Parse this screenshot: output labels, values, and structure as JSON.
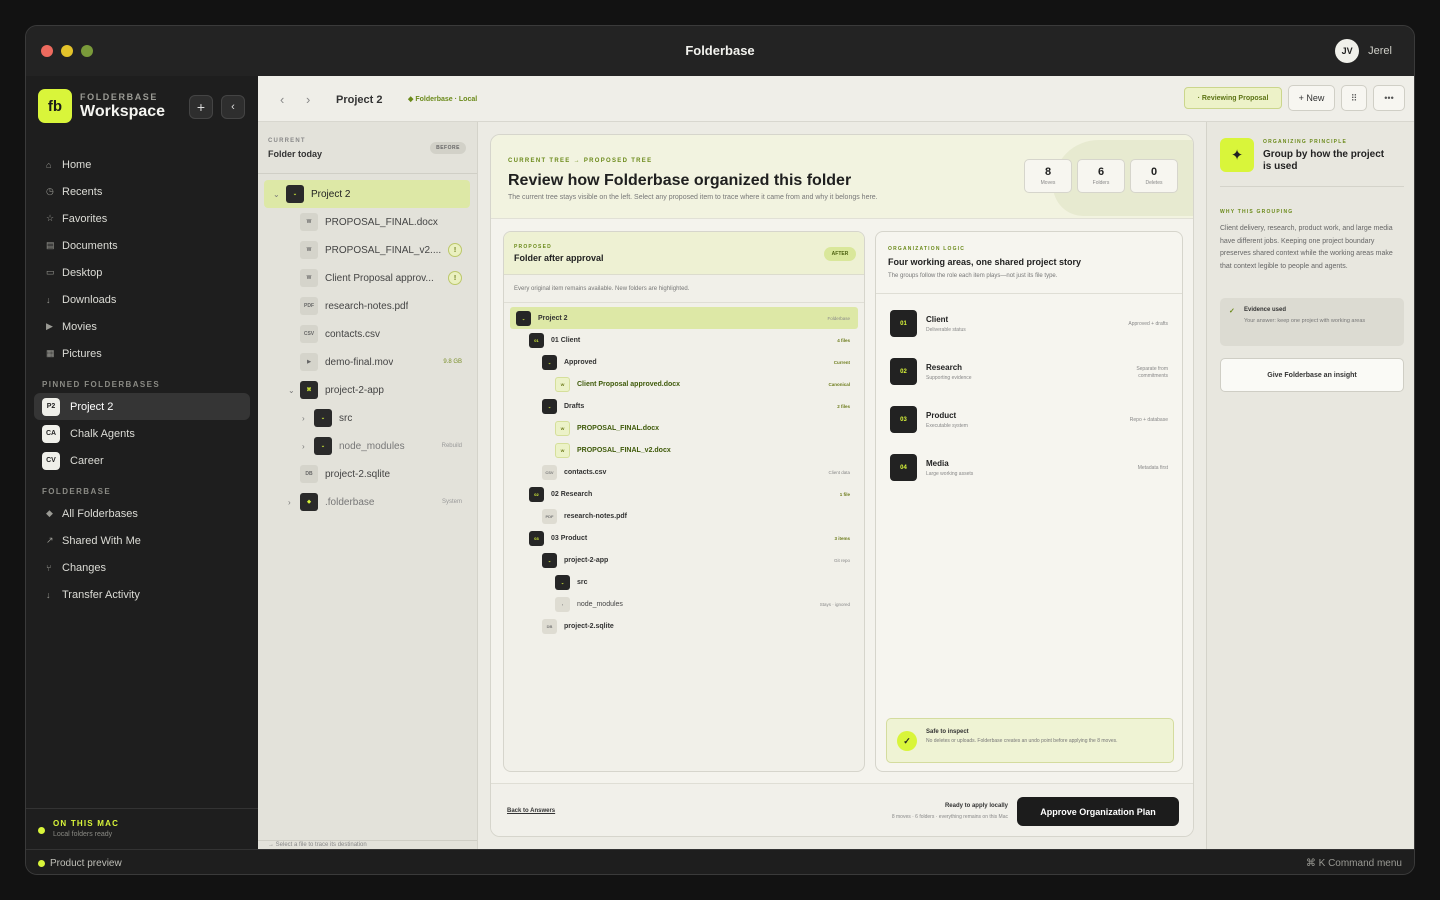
{
  "window": {
    "title": "Folderbase",
    "user_initials": "JV",
    "user_name": "Jerel"
  },
  "sidebar": {
    "brand_small": "FOLDERBASE",
    "brand_big": "Workspace",
    "logo": "fb",
    "nav": [
      {
        "label": "Home",
        "icon": "home-icon"
      },
      {
        "label": "Recents",
        "icon": "clock-icon"
      },
      {
        "label": "Favorites",
        "icon": "star-icon"
      },
      {
        "label": "Documents",
        "icon": "document-icon"
      },
      {
        "label": "Desktop",
        "icon": "desktop-icon"
      },
      {
        "label": "Downloads",
        "icon": "download-icon"
      },
      {
        "label": "Movies",
        "icon": "play-icon"
      },
      {
        "label": "Pictures",
        "icon": "image-icon"
      }
    ],
    "pinned_title": "PINNED FOLDERBASES",
    "pinned": [
      {
        "badge": "P2",
        "label": "Project 2"
      },
      {
        "badge": "CA",
        "label": "Chalk Agents"
      },
      {
        "badge": "CV",
        "label": "Career"
      }
    ],
    "folderbase_title": "FOLDERBASE",
    "folderbase_nav": [
      {
        "label": "All Folderbases",
        "icon": "diamond-icon"
      },
      {
        "label": "Shared With Me",
        "icon": "share-icon"
      },
      {
        "label": "Changes",
        "icon": "branch-icon"
      },
      {
        "label": "Transfer Activity",
        "icon": "transfer-icon"
      }
    ],
    "footer_title": "ON THIS MAC",
    "footer_sub": "Local folders ready"
  },
  "toolbar": {
    "title": "Project 2",
    "crumb": "◆ Folderbase · Local",
    "status_pill": "· Reviewing Proposal",
    "new_label": "+ New"
  },
  "current": {
    "label": "CURRENT",
    "title": "Folder today",
    "pill": "BEFORE",
    "footer": "→  Select a file to trace its destination",
    "rows": [
      {
        "name": "Project 2",
        "icon": "⌄",
        "meta": ""
      },
      {
        "name": "PROPOSAL_FINAL.docx",
        "icon": "W",
        "meta": ""
      },
      {
        "name": "PROPOSAL_FINAL_v2....",
        "icon": "W",
        "meta": "!"
      },
      {
        "name": "Client Proposal approv...",
        "icon": "W",
        "meta": "!"
      },
      {
        "name": "research-notes.pdf",
        "icon": "PDF",
        "meta": ""
      },
      {
        "name": "contacts.csv",
        "icon": "CSV",
        "meta": ""
      },
      {
        "name": "demo-final.mov",
        "icon": "▶",
        "meta": "9.8 GB"
      },
      {
        "name": "project-2-app",
        "icon": "⌘",
        "meta": ""
      },
      {
        "name": "src",
        "icon": "⌄",
        "meta": ""
      },
      {
        "name": "node_modules",
        "icon": "⌄",
        "meta": "Rebuild"
      },
      {
        "name": "project-2.sqlite",
        "icon": "DB",
        "meta": ""
      },
      {
        "name": ".folderbase",
        "icon": "◆",
        "meta": "System"
      }
    ]
  },
  "hero": {
    "eyebrow": "CURRENT TREE → PROPOSED TREE",
    "title": "Review how Folderbase organized this folder",
    "subtitle": "The current tree stays visible on the left. Select any proposed item to trace where it came from and why it belongs here.",
    "stats": [
      {
        "num": "8",
        "label": "Moves"
      },
      {
        "num": "6",
        "label": "Folders"
      },
      {
        "num": "0",
        "label": "Deletes"
      }
    ]
  },
  "proposed": {
    "eyebrow": "PROPOSED",
    "title": "Folder after approval",
    "pill": "AFTER",
    "note": "Every original item remains available. New folders are highlighted.",
    "rows": [
      {
        "name": "Project 2",
        "icon": "⌄",
        "meta": "Folderbase"
      },
      {
        "name": "01 Client",
        "icon": "01",
        "meta": "4 files"
      },
      {
        "name": "Approved",
        "icon": "⌄",
        "meta": "Current"
      },
      {
        "name": "Client Proposal approved.docx",
        "icon": "W",
        "meta": "Canonical"
      },
      {
        "name": "Drafts",
        "icon": "⌄",
        "meta": "2 files"
      },
      {
        "name": "PROPOSAL_FINAL.docx",
        "icon": "W",
        "meta": ""
      },
      {
        "name": "PROPOSAL_FINAL_v2.docx",
        "icon": "W",
        "meta": ""
      },
      {
        "name": "contacts.csv",
        "icon": "CSV",
        "meta": "Client data"
      },
      {
        "name": "02 Research",
        "icon": "02",
        "meta": "1 file"
      },
      {
        "name": "research-notes.pdf",
        "icon": "PDF",
        "meta": ""
      },
      {
        "name": "03 Product",
        "icon": "03",
        "meta": "3 items"
      },
      {
        "name": "project-2-app",
        "icon": "⌄",
        "meta": "Git repo"
      },
      {
        "name": "src",
        "icon": "⌄",
        "meta": ""
      },
      {
        "name": "node_modules",
        "icon": "›",
        "meta": "Stays · ignored"
      },
      {
        "name": "project-2.sqlite",
        "icon": "DB",
        "meta": ""
      }
    ]
  },
  "logic": {
    "eyebrow": "ORGANIZATION LOGIC",
    "title": "Four working areas, one shared project story",
    "subtitle": "The groups follow the role each item plays—not just its file type.",
    "areas": [
      {
        "num": "01",
        "name": "Client",
        "sub": "Deliverable status",
        "meta": "Approved + drafts"
      },
      {
        "num": "02",
        "name": "Research",
        "sub": "Supporting evidence",
        "meta": "Separate from commitments"
      },
      {
        "num": "03",
        "name": "Product",
        "sub": "Executable system",
        "meta": "Repo + database"
      },
      {
        "num": "04",
        "name": "Media",
        "sub": "Large working assets",
        "meta": "Metadata first"
      }
    ],
    "safe_title": "Safe to inspect",
    "safe_text": "No deletes or uploads. Folderbase creates an undo point before applying the 8 moves."
  },
  "footer": {
    "back": "Back to Answers",
    "ready_title": "Ready to apply locally",
    "ready_sub": "8 moves · 6 folders · everything remains on this Mac",
    "approve": "Approve Organization Plan"
  },
  "principle": {
    "eyebrow": "ORGANIZING PRINCIPLE",
    "title": "Group by how the project is used",
    "why": "WHY THIS GROUPING",
    "body": "Client delivery, research, product work, and large media have different jobs. Keeping one project boundary preserves shared context while the working areas make that context legible to people and agents.",
    "evidence_title": "Evidence used",
    "evidence_text": "Your answer: keep one project with working areas",
    "insight_btn": "Give Folderbase an insight"
  },
  "statusbar": {
    "left": "Product preview",
    "right": "⌘ K   Command menu"
  },
  "colors": {
    "accent": "#d9f53a",
    "sidebar_bg": "#1e1e1e",
    "content_bg": "#ecebe4"
  }
}
